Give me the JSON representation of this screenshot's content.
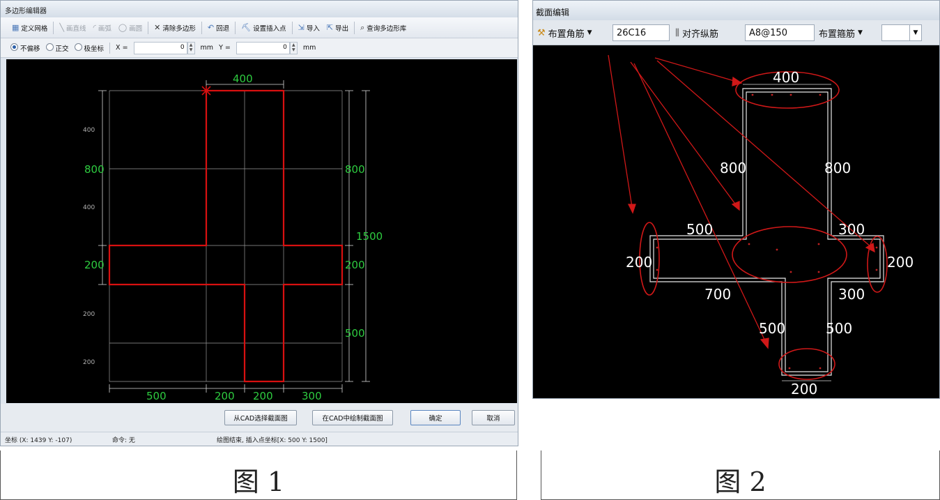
{
  "fig1": {
    "title": "多边形编辑器",
    "toolbar": {
      "define_grid": "定义网格",
      "draw_line": "画直线",
      "draw_arc": "画弧",
      "draw_circle": "画圆",
      "clear_polygon": "清除多边形",
      "undo": "回退",
      "set_insert_point": "设置插入点",
      "import": "导入",
      "export": "导出",
      "query_library": "查询多边形库"
    },
    "options": {
      "no_offset": "不偏移",
      "orthogonal": "正交",
      "polar": "极坐标",
      "x_label": "X =",
      "x_value": "0",
      "x_unit": "mm",
      "y_label": "Y =",
      "y_value": "0",
      "y_unit": "mm"
    },
    "drawing": {
      "top_width": "400",
      "left_upper": "800",
      "right_upper": "800",
      "right_total": "1500",
      "left_mid": "200",
      "right_mid": "200",
      "right_lower": "500",
      "bottom_1": "500",
      "bottom_2": "200",
      "bottom_3": "200",
      "bottom_4": "300",
      "grid_l1": "400",
      "grid_l2": "400",
      "grid_l3": "200",
      "grid_l4": "200"
    },
    "buttons": {
      "select_from_cad": "从CAD选择截面图",
      "draw_in_cad": "在CAD中绘制截面图",
      "ok": "确定",
      "cancel": "取消"
    },
    "status": {
      "coords": "坐标 (X: 1439 Y: -107)",
      "command": "命令: 无",
      "message": "绘图结束, 插入点坐标[X: 500 Y: 1500]"
    }
  },
  "fig2": {
    "title": "截面编辑",
    "toolbar": {
      "corner_rebar": "布置角筋",
      "corner_value": "26C16",
      "align_rebar": "对齐纵筋",
      "align_value": "A8@150",
      "stirrup": "布置箍筋"
    },
    "drawing": {
      "top": "400",
      "left_upper": "800",
      "right_upper": "800",
      "left_flange": "500",
      "right_flange": "300",
      "left_end": "200",
      "right_end": "200",
      "left_under": "700",
      "right_under": "300",
      "left_lower": "500",
      "right_lower": "500",
      "bottom": "200"
    }
  },
  "captions": {
    "fig1": "图 1",
    "fig2": "图 2"
  },
  "colors": {
    "polygon": "#d81010",
    "dimension": "#2ecc40",
    "canvas": "#000000",
    "annotation": "#d01818"
  }
}
